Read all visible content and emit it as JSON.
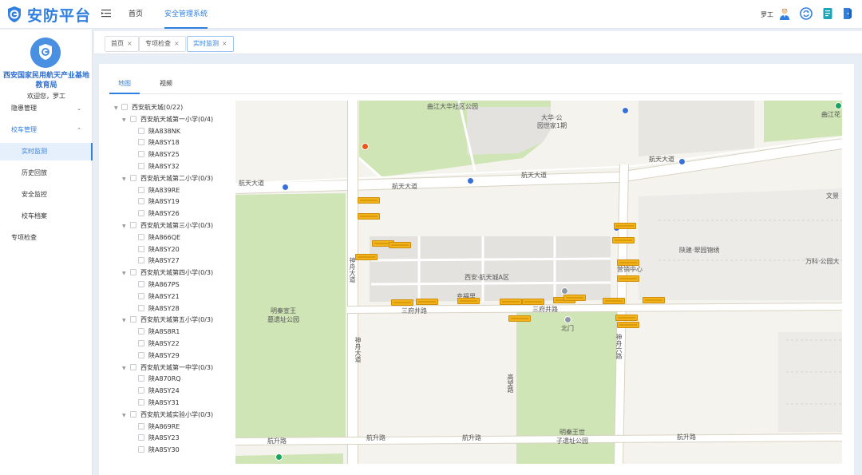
{
  "app": {
    "title": "安防平台",
    "nav": {
      "home": "首页",
      "safety": "安全管理系统"
    },
    "user": "罗工"
  },
  "sidebar": {
    "org_name": "西安国家民用航天产业基地教育局",
    "welcome": "欢迎您，罗工",
    "items": [
      {
        "label": "隐患管理",
        "caret": "⌄"
      },
      {
        "label": "校车管理",
        "caret": "⌃"
      },
      {
        "label": "实时监测"
      },
      {
        "label": "历史回放"
      },
      {
        "label": "安全监控"
      },
      {
        "label": "校车档案"
      },
      {
        "label": "专项检查"
      }
    ]
  },
  "tabs": [
    {
      "label": "首页",
      "close": "×"
    },
    {
      "label": "专项检查",
      "close": "×"
    },
    {
      "label": "实时监测",
      "close": "×"
    }
  ],
  "view_tabs": {
    "map": "地图",
    "video": "视频"
  },
  "tree": {
    "root": "西安航天城(0/22)",
    "groups": [
      {
        "name": "西安航天城第一小学(0/4)",
        "vehicles": [
          "陕A838NK",
          "陕A8SY18",
          "陕A8SY25",
          "陕A8SY32"
        ]
      },
      {
        "name": "西安航天城第二小学(0/3)",
        "vehicles": [
          "陕A839RE",
          "陕A8SY19",
          "陕A8SY26"
        ]
      },
      {
        "name": "西安航天城第三小学(0/3)",
        "vehicles": [
          "陕A866QE",
          "陕A8SY20",
          "陕A8SY27"
        ]
      },
      {
        "name": "西安航天城第四小学(0/3)",
        "vehicles": [
          "陕A867PS",
          "陕A8SY21",
          "陕A8SY28"
        ]
      },
      {
        "name": "西安航天城第五小学(0/3)",
        "vehicles": [
          "陕A8S8R1",
          "陕A8SY22",
          "陕A8SY29"
        ]
      },
      {
        "name": "西安航天城第一中学(0/3)",
        "vehicles": [
          "陕A870RQ",
          "陕A8SY24",
          "陕A8SY31"
        ]
      },
      {
        "name": "西安航天城实验小学(0/3)",
        "vehicles": [
          "陕A869RE",
          "陕A8SY23",
          "陕A8SY30"
        ]
      }
    ]
  },
  "map": {
    "labels": {
      "park_top": "曲江大华社区公园",
      "dahua": "大华·公",
      "world": "园世家1期",
      "road_hangtian_1": "航天大道",
      "road_hangtian_2": "航天大道",
      "road_hangtian_3": "航天大道",
      "road_hangtian_4": "航天大道",
      "shenzhou": "神舟大道",
      "shenzhou_2": "神舟大道",
      "ming_park": "明秦宣王",
      "ming_park_2": "墓遗址公园",
      "district": "西安·航天城A区",
      "sanfu_1": "三府井路",
      "sanfu_2": "三府井路",
      "beimen": "北门",
      "shenzhou6": "神舟六路",
      "gaowang": "高望路",
      "mingqin": "明秦王世",
      "mingqin_2": "子遗址公园",
      "hangsheng_1": "航升路",
      "hangsheng_2": "航升路",
      "hangsheng_3": "航升路",
      "hangsheng_4": "航升路",
      "chuangyi": "陕建·翠园锦绣",
      "wanke": "万科·公园大",
      "yingxiao": "营销中心",
      "xiaoyuan": "幸福里",
      "wenjing": "文景",
      "qujiang_flower": "曲江花",
      "bei_gate_label": "北门"
    },
    "colors": {
      "road": "#ffffff",
      "road_edge": "#d9d3c4",
      "park": "#cfe5b5",
      "building": "#e4e2de",
      "bus": "#f2b21b"
    }
  }
}
